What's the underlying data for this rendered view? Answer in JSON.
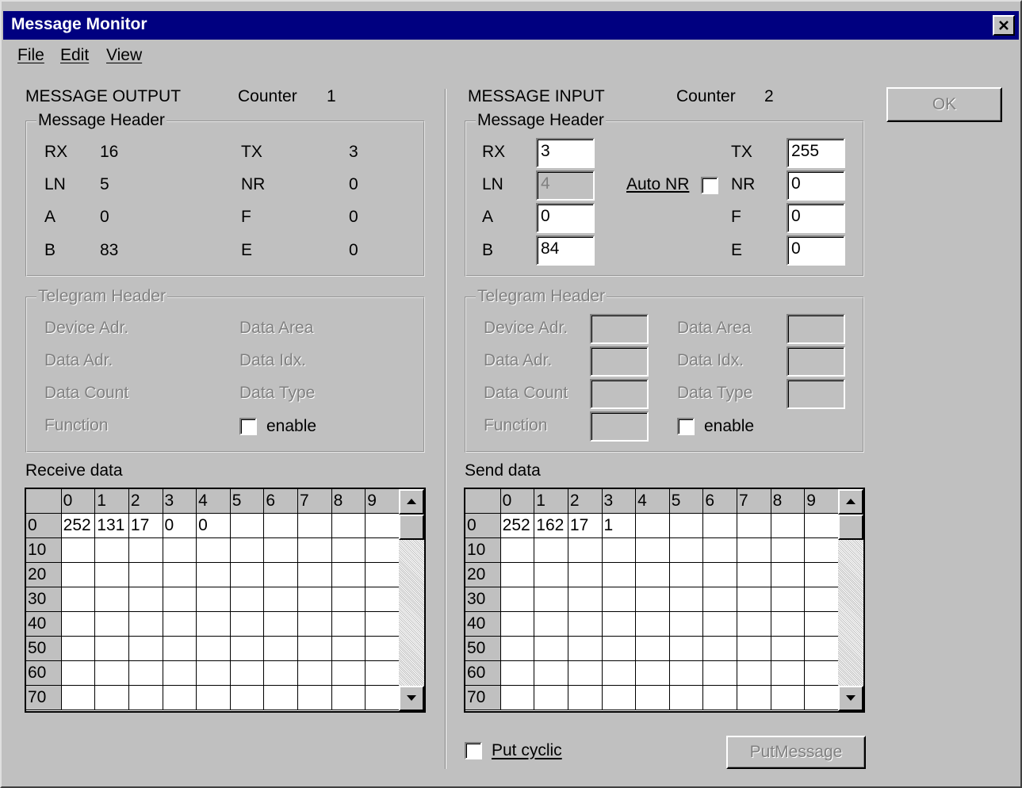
{
  "window": {
    "title": "Message Monitor"
  },
  "menu": [
    "File",
    "Edit",
    "View"
  ],
  "buttons": {
    "ok": "OK",
    "put_message": "PutMessage"
  },
  "output": {
    "title": "MESSAGE OUTPUT",
    "counter_label": "Counter",
    "counter": "1",
    "header_group": "Message Header",
    "rx_label": "RX",
    "rx": "16",
    "tx_label": "TX",
    "tx": "3",
    "ln_label": "LN",
    "ln": "5",
    "nr_label": "NR",
    "nr": "0",
    "a_label": "A",
    "a": "0",
    "f_label": "F",
    "f": "0",
    "b_label": "B",
    "b": "83",
    "e_label": "E",
    "e": "0",
    "telegram_group": "Telegram Header",
    "device_adr": "Device Adr.",
    "data_area": "Data Area",
    "data_adr": "Data Adr.",
    "data_idx": "Data Idx.",
    "data_count": "Data Count",
    "data_type": "Data Type",
    "function": "Function",
    "enable": "enable",
    "grid_label": "Receive data"
  },
  "input": {
    "title": "MESSAGE INPUT",
    "counter_label": "Counter",
    "counter": "2",
    "header_group": "Message Header",
    "rx_label": "RX",
    "rx": "3",
    "tx_label": "TX",
    "tx": "255",
    "ln_label": "LN",
    "ln": "4",
    "auto_nr": "Auto NR",
    "nr_label": "NR",
    "nr": "0",
    "a_label": "A",
    "a": "0",
    "f_label": "F",
    "f": "0",
    "b_label": "B",
    "b": "84",
    "e_label": "E",
    "e": "0",
    "telegram_group": "Telegram Header",
    "device_adr": "Device Adr.",
    "data_area": "Data Area",
    "data_adr": "Data Adr.",
    "data_idx": "Data Idx.",
    "data_count": "Data Count",
    "data_type": "Data Type",
    "function": "Function",
    "enable": "enable",
    "grid_label": "Send data",
    "put_cyclic": "Put cyclic"
  },
  "grid_columns": [
    "0",
    "1",
    "2",
    "3",
    "4",
    "5",
    "6",
    "7",
    "8",
    "9"
  ],
  "grid_rows": [
    "0",
    "10",
    "20",
    "30",
    "40",
    "50",
    "60",
    "70"
  ],
  "receive_data": [
    [
      "252",
      "131",
      "17",
      "0",
      "0",
      "",
      "",
      "",
      "",
      ""
    ]
  ],
  "send_data": [
    [
      "252",
      "162",
      "17",
      "1",
      "",
      "",
      "",
      "",
      "",
      ""
    ]
  ]
}
